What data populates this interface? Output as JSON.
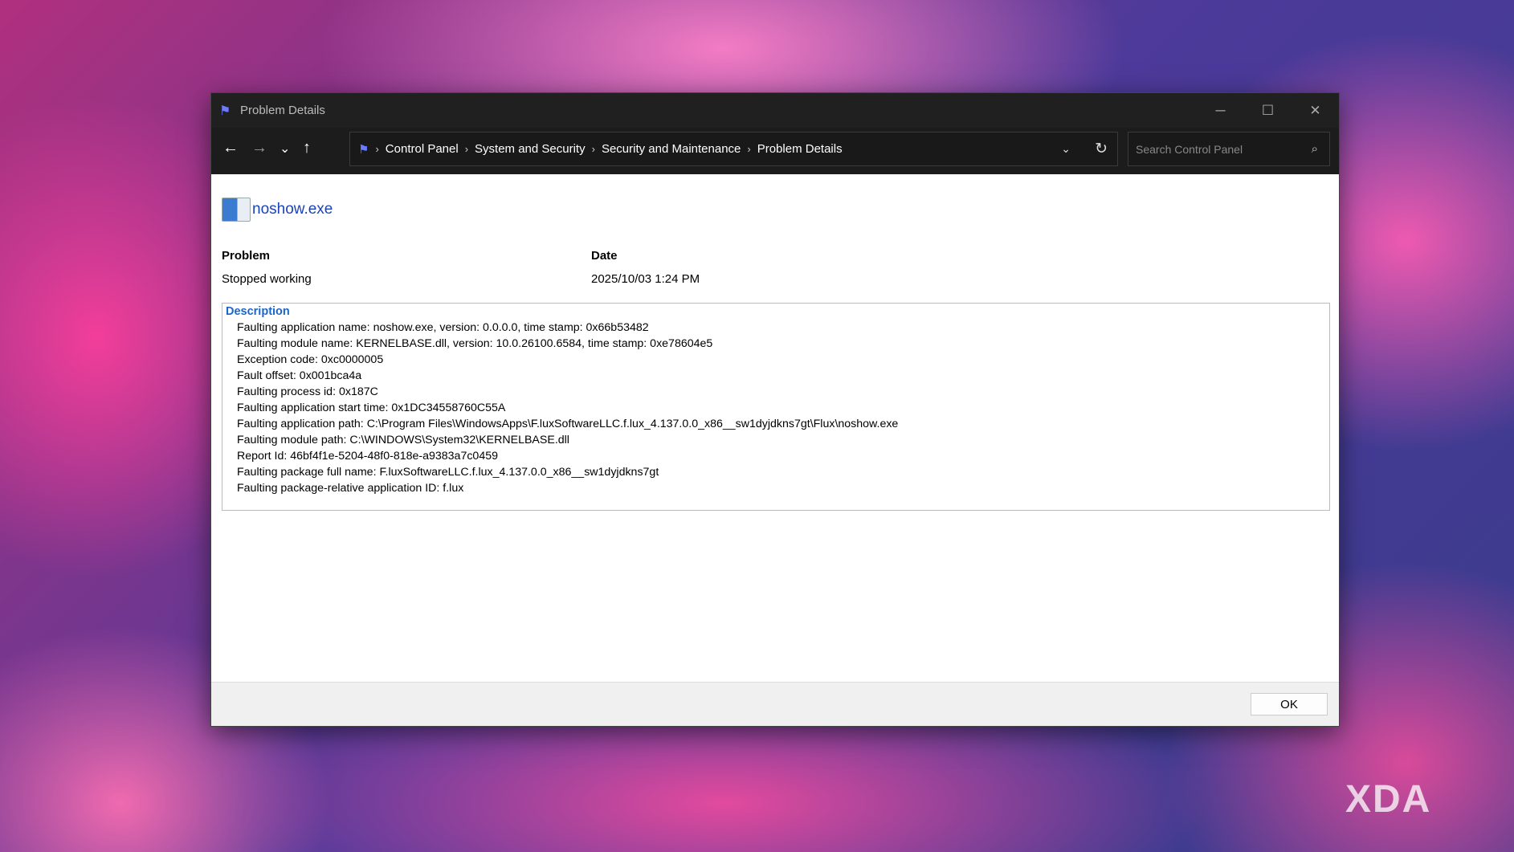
{
  "window": {
    "title": "Problem Details",
    "minimize": "─",
    "maximize": "☐",
    "close": "✕"
  },
  "nav": {
    "back": "←",
    "forward": "→",
    "recent": "⌄",
    "up": "↑"
  },
  "address": {
    "crumbs": [
      "Control Panel",
      "System and Security",
      "Security and Maintenance",
      "Problem Details"
    ],
    "separator": "›",
    "dropdown": "⌄",
    "refresh": "↻"
  },
  "search": {
    "placeholder": "Search Control Panel",
    "icon": "⌕"
  },
  "app": {
    "name": "noshow.exe"
  },
  "problem": {
    "label": "Problem",
    "value": "Stopped working"
  },
  "date": {
    "label": "Date",
    "value": "2025/10/03 1:24 PM"
  },
  "description": {
    "heading": "Description",
    "lines": [
      "Faulting application name: noshow.exe, version: 0.0.0.0, time stamp: 0x66b53482",
      "Faulting module name: KERNELBASE.dll, version: 10.0.26100.6584, time stamp: 0xe78604e5",
      "Exception code: 0xc0000005",
      "Fault offset: 0x001bca4a",
      "Faulting process id: 0x187C",
      "Faulting application start time: 0x1DC34558760C55A",
      "Faulting application path: C:\\Program Files\\WindowsApps\\F.luxSoftwareLLC.f.lux_4.137.0.0_x86__sw1dyjdkns7gt\\Flux\\noshow.exe",
      "Faulting module path: C:\\WINDOWS\\System32\\KERNELBASE.dll",
      "Report Id: 46bf4f1e-5204-48f0-818e-a9383a7c0459",
      "Faulting package full name: F.luxSoftwareLLC.f.lux_4.137.0.0_x86__sw1dyjdkns7gt",
      "Faulting package-relative application ID: f.lux"
    ]
  },
  "footer": {
    "ok": "OK"
  },
  "watermark": "XDA"
}
